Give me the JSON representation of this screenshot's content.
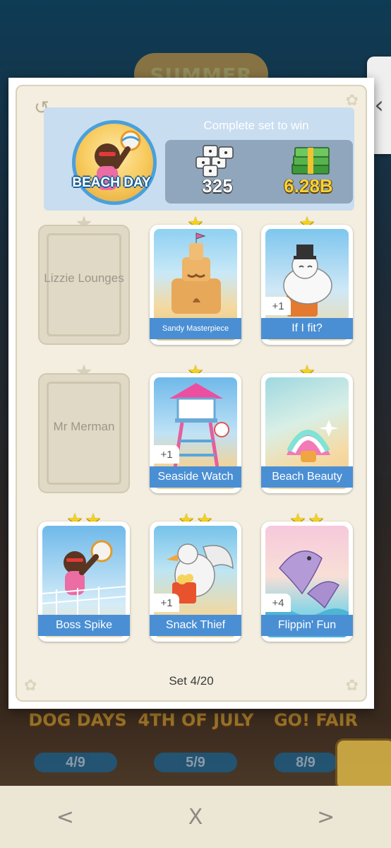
{
  "background": {
    "event_title": "SUMMER",
    "other_sets": [
      {
        "name": "DOG DAYS",
        "progress": "4/9"
      },
      {
        "name": "4TH OF JULY",
        "progress": "5/9"
      },
      {
        "name": "GO! FAIR",
        "progress": "8/9"
      }
    ]
  },
  "album": {
    "set_name": "BEACH DAY",
    "reward_title": "Complete set to win",
    "rewards": {
      "dice": "325",
      "cash": "6.28B"
    },
    "set_counter": "Set 4/20"
  },
  "cards": [
    {
      "name": "Lizzie Lounges",
      "stars": 1,
      "owned": false
    },
    {
      "name": "Sandy Masterpiece",
      "stars": 1,
      "owned": true,
      "extra": ""
    },
    {
      "name": "If I fit?",
      "stars": 1,
      "owned": true,
      "extra": "+1"
    },
    {
      "name": "Mr Merman",
      "stars": 1,
      "owned": false
    },
    {
      "name": "Seaside Watch",
      "stars": 1,
      "owned": true,
      "extra": "+1"
    },
    {
      "name": "Beach Beauty",
      "stars": 1,
      "owned": true,
      "extra": ""
    },
    {
      "name": "Boss Spike",
      "stars": 2,
      "owned": true,
      "extra": ""
    },
    {
      "name": "Snack Thief",
      "stars": 2,
      "owned": true,
      "extra": "+1"
    },
    {
      "name": "Flippin' Fun",
      "stars": 2,
      "owned": true,
      "extra": "+4"
    }
  ],
  "nav": {
    "prev": "<",
    "close": "X",
    "next": ">"
  },
  "colors": {
    "label_blue": "#4a8fd4",
    "star_gold": "#f5d21e",
    "header_blue": "#c9ddf0"
  }
}
